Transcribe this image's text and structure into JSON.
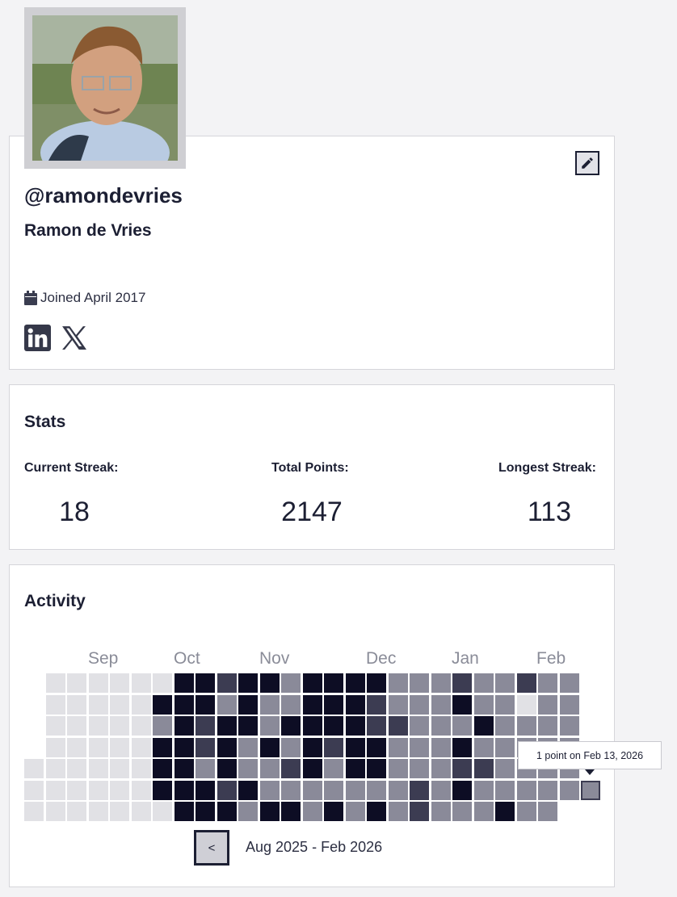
{
  "profile": {
    "username": "@ramondevries",
    "full_name": "Ramon de Vries",
    "joined": "Joined April 2017",
    "avatar_alt": "Profile photo",
    "socials": [
      "linkedin-icon",
      "x-icon"
    ],
    "edit_icon": "pencil-icon"
  },
  "stats": {
    "title": "Stats",
    "current_streak_label": "Current Streak:",
    "current_streak": "18",
    "total_points_label": "Total Points:",
    "total_points": "2147",
    "longest_streak_label": "Longest Streak:",
    "longest_streak": "113"
  },
  "activity": {
    "title": "Activity",
    "months": [
      "Sep",
      "Oct",
      "Nov",
      "Dec",
      "Jan",
      "Feb"
    ],
    "tooltip": "1 point on Feb 13, 2026",
    "prev_label": "<",
    "range": "Aug 2025 - Feb 2026",
    "legend_colors": [
      "#e1e1e5",
      "#8a8a99",
      "#3c3c52",
      "#0d0d24"
    ],
    "weeks": [
      [
        null,
        null,
        null,
        null,
        0,
        0,
        0
      ],
      [
        0,
        0,
        0,
        0,
        0,
        0,
        0
      ],
      [
        0,
        0,
        0,
        0,
        0,
        0,
        0
      ],
      [
        0,
        0,
        0,
        0,
        0,
        0,
        0
      ],
      [
        0,
        0,
        0,
        0,
        0,
        0,
        0
      ],
      [
        0,
        0,
        0,
        0,
        0,
        0,
        0
      ],
      [
        0,
        3,
        1,
        3,
        3,
        3,
        0
      ],
      [
        3,
        3,
        3,
        3,
        3,
        3,
        3
      ],
      [
        3,
        3,
        2,
        2,
        1,
        3,
        3
      ],
      [
        2,
        1,
        3,
        3,
        3,
        2,
        3
      ],
      [
        3,
        3,
        3,
        1,
        1,
        3,
        1
      ],
      [
        3,
        1,
        1,
        3,
        1,
        1,
        3
      ],
      [
        1,
        1,
        3,
        1,
        2,
        1,
        3
      ],
      [
        3,
        3,
        3,
        3,
        3,
        1,
        1
      ],
      [
        3,
        3,
        3,
        2,
        1,
        1,
        3
      ],
      [
        3,
        3,
        3,
        3,
        3,
        1,
        1
      ],
      [
        3,
        2,
        2,
        3,
        3,
        1,
        3
      ],
      [
        1,
        1,
        2,
        1,
        1,
        1,
        1
      ],
      [
        1,
        1,
        1,
        1,
        1,
        2,
        2
      ],
      [
        1,
        1,
        1,
        1,
        1,
        1,
        1
      ],
      [
        2,
        3,
        1,
        3,
        2,
        3,
        1
      ],
      [
        1,
        1,
        3,
        1,
        2,
        1,
        1
      ],
      [
        1,
        1,
        1,
        1,
        1,
        1,
        3
      ],
      [
        2,
        0,
        1,
        1,
        1,
        1,
        1
      ],
      [
        1,
        1,
        1,
        1,
        1,
        1,
        1
      ],
      [
        1,
        1,
        1,
        1,
        1,
        1,
        null
      ]
    ],
    "highlighted_cell": {
      "week": 26,
      "day": 5,
      "level": 1
    }
  }
}
